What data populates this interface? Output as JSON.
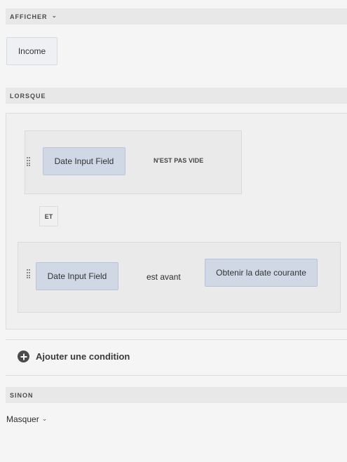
{
  "show_section": {
    "title": "AFFICHER",
    "target_token": "Income"
  },
  "when_section": {
    "title": "LORSQUE",
    "condition1": {
      "field": "Date Input Field",
      "operator": "N'EST PAS VIDE"
    },
    "conjunction": "ET",
    "condition2": {
      "field": "Date Input Field",
      "operator": "est avant",
      "value": "Obtenir la date courante"
    }
  },
  "add_condition_label": "Ajouter une condition",
  "else_section": {
    "title": "SINON",
    "action": "Masquer"
  },
  "icons": {
    "afficher_chevron": "chevron-down-icon",
    "masquer_chevron": "chevron-down-icon",
    "add": "plus-circle-icon",
    "grip": "drag-handle-icon"
  }
}
